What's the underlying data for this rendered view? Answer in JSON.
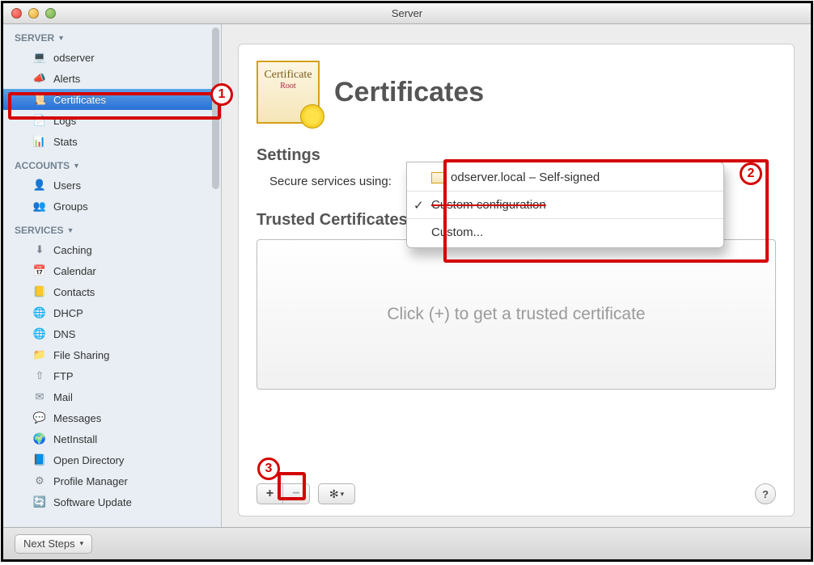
{
  "window": {
    "title": "Server"
  },
  "sidebar": {
    "sections": [
      {
        "heading": "SERVER",
        "items": [
          {
            "label": "odserver",
            "icon": "💻"
          },
          {
            "label": "Alerts",
            "icon": "📣"
          },
          {
            "label": "Certificates",
            "icon": "📜",
            "selected": true
          },
          {
            "label": "Logs",
            "icon": "📄"
          },
          {
            "label": "Stats",
            "icon": "📊"
          }
        ]
      },
      {
        "heading": "ACCOUNTS",
        "items": [
          {
            "label": "Users",
            "icon": "👤"
          },
          {
            "label": "Groups",
            "icon": "👥"
          }
        ]
      },
      {
        "heading": "SERVICES",
        "items": [
          {
            "label": "Caching",
            "icon": "⬇"
          },
          {
            "label": "Calendar",
            "icon": "📅"
          },
          {
            "label": "Contacts",
            "icon": "📒"
          },
          {
            "label": "DHCP",
            "icon": "🌐"
          },
          {
            "label": "DNS",
            "icon": "🌐"
          },
          {
            "label": "File Sharing",
            "icon": "📁"
          },
          {
            "label": "FTP",
            "icon": "⇧"
          },
          {
            "label": "Mail",
            "icon": "✉"
          },
          {
            "label": "Messages",
            "icon": "💬"
          },
          {
            "label": "NetInstall",
            "icon": "🌍"
          },
          {
            "label": "Open Directory",
            "icon": "📘"
          },
          {
            "label": "Profile Manager",
            "icon": "⚙"
          },
          {
            "label": "Software Update",
            "icon": "🔄"
          }
        ]
      }
    ]
  },
  "page": {
    "title": "Certificates",
    "icon_text1": "Certificate",
    "icon_text2": "Root",
    "settings_heading": "Settings",
    "secure_label": "Secure services using:",
    "trusted_heading": "Trusted Certificates",
    "placeholder": "Click (+) to get a trusted certificate"
  },
  "dropdown": {
    "items": [
      {
        "label": "odserver.local – Self-signed",
        "icon": true
      },
      {
        "label": "Custom configuration",
        "checked": true,
        "struck": true
      },
      {
        "label": "Custom..."
      }
    ]
  },
  "toolbar": {
    "add": "+",
    "remove": "−",
    "gear": "✻",
    "gear_arrow": "▾",
    "help": "?"
  },
  "bottombar": {
    "next_steps": "Next Steps",
    "arrow": "▾"
  },
  "annotations": {
    "n1": "1",
    "n2": "2",
    "n3": "3"
  }
}
